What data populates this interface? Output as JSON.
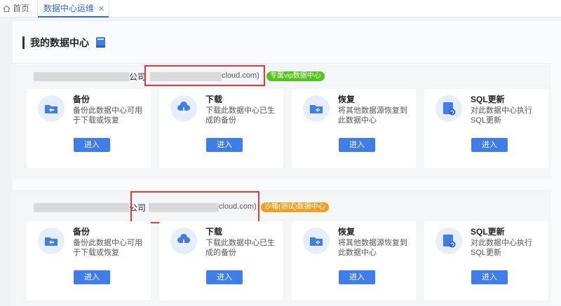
{
  "tabs": [
    {
      "label": "首页"
    },
    {
      "label": "数据中心运维",
      "close": "✕"
    }
  ],
  "page": {
    "title": "我的数据中心"
  },
  "datacenters": [
    {
      "company_suffix": "公司",
      "domain_suffix": "cloud.com)",
      "tag": "专属vip数据中心",
      "tag_color": "#52c41a",
      "cards": [
        {
          "title": "备份",
          "desc": "备份此数据中心可用于下载或恢复",
          "button": "进入",
          "icon": "backup-icon"
        },
        {
          "title": "下载",
          "desc": "下载此数据中心已生成的备份",
          "button": "进入",
          "icon": "cloud-download-icon"
        },
        {
          "title": "恢复",
          "desc": "将其他数据源恢复到此数据中心",
          "button": "进入",
          "icon": "restore-folder-icon"
        },
        {
          "title": "SQL更新",
          "desc": "对此数据中心执行SQL更新",
          "button": "进入",
          "icon": "sql-update-icon"
        }
      ]
    },
    {
      "company_suffix": "公司",
      "domain_suffix": "cloud.com)",
      "tag": "沙箱(测试)数据中心",
      "tag_color": "#f0a020",
      "cards": [
        {
          "title": "备份",
          "desc": "备份此数据中心可用于下载或恢复",
          "button": "进入",
          "icon": "backup-icon"
        },
        {
          "title": "下载",
          "desc": "下载此数据中心已生成的备份",
          "button": "进入",
          "icon": "cloud-download-icon"
        },
        {
          "title": "恢复",
          "desc": "将其他数据源恢复到此数据中心",
          "button": "进入",
          "icon": "restore-folder-icon"
        },
        {
          "title": "SQL更新",
          "desc": "对此数据中心执行SQL更新",
          "button": "进入",
          "icon": "sql-update-icon"
        }
      ]
    }
  ],
  "colors": {
    "accent": "#3f7de8",
    "icon_bg": "#e6edfb",
    "highlight_box": "#e53935"
  }
}
